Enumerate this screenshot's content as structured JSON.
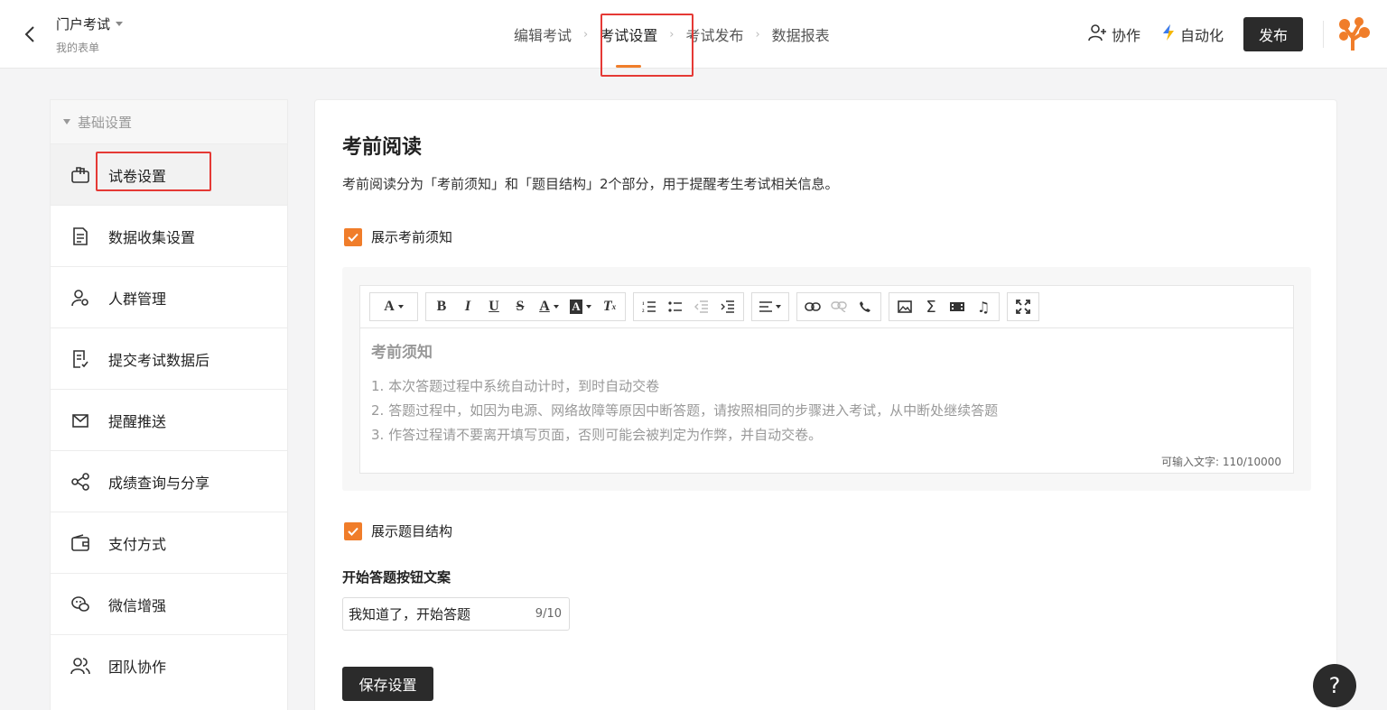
{
  "header": {
    "form_title": "门户考试",
    "form_subtitle": "我的表单",
    "steps": [
      {
        "label": "编辑考试"
      },
      {
        "label": "考试设置"
      },
      {
        "label": "考试发布"
      },
      {
        "label": "数据报表"
      }
    ],
    "collab_label": "协作",
    "automation_label": "自动化",
    "publish_label": "发布"
  },
  "sidebar": {
    "group_label": "基础设置",
    "items": [
      {
        "label": "试卷设置",
        "icon": "paper-settings-icon"
      },
      {
        "label": "数据收集设置",
        "icon": "document-icon"
      },
      {
        "label": "人群管理",
        "icon": "user-settings-icon"
      },
      {
        "label": "提交考试数据后",
        "icon": "submit-doc-icon"
      },
      {
        "label": "提醒推送",
        "icon": "mail-icon"
      },
      {
        "label": "成绩查询与分享",
        "icon": "share-icon"
      },
      {
        "label": "支付方式",
        "icon": "wallet-icon"
      },
      {
        "label": "微信增强",
        "icon": "wechat-icon"
      },
      {
        "label": "团队协作",
        "icon": "team-icon"
      }
    ]
  },
  "main": {
    "title": "考前阅读",
    "description": "考前阅读分为「考前须知」和「题目结构」2个部分，用于提醒考生考试相关信息。",
    "show_notice_label": "展示考前须知",
    "editor": {
      "heading": "考前须知",
      "lines": [
        "1. 本次答题过程中系统自动计时，到时自动交卷",
        "2. 答题过程中，如因为电源、网络故障等原因中断答题，请按照相同的步骤进入考试，从中断处继续答题",
        "3. 作答过程请不要离开填写页面，否则可能会被判定为作弊，并自动交卷。"
      ],
      "counter": "可输入文字: 110/10000"
    },
    "show_structure_label": "展示题目结构",
    "start_button_label": "开始答题按钮文案",
    "start_button_value": "我知道了，开始答题",
    "start_button_count": "9/10",
    "save_label": "保存设置"
  },
  "help_label": "?",
  "colors": {
    "accent": "#f07d2a",
    "dark": "#2b2b2b",
    "highlight_box": "#e53935"
  }
}
